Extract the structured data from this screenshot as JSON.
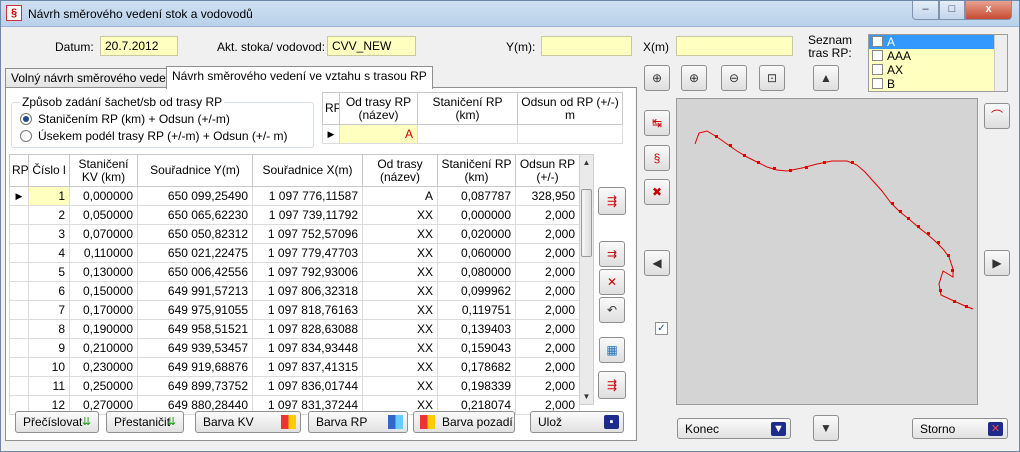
{
  "window": {
    "title": "Návrh směrového vedení stok a vodovodů",
    "min_glyph": "–",
    "max_glyph": "□",
    "close_glyph": "x"
  },
  "header": {
    "datum_label": "Datum:",
    "datum_value": "20.7.2012",
    "stoka_label": "Akt. stoka/ vodovod:",
    "stoka_value": "CVV_NEW",
    "y_label": "Y(m):",
    "y_value": "",
    "x_label": "X(m)",
    "x_value": "",
    "seznam_label": "Seznam tras RP:"
  },
  "trasy": [
    "A",
    "AAA",
    "AX",
    "B"
  ],
  "tabs": [
    "Volný návrh směrového vedení",
    "Návrh směrového vedení ve vztahu s trasou RP"
  ],
  "mode": {
    "title": "Způsob zadání šachet/sb od trasy RP",
    "opt1": "Staničením RP (km) + Odsun (+/-m)",
    "opt2": "Úsekem podél trasy RP (+/-m) + Odsun (+/- m)"
  },
  "rp_grid": {
    "headers": [
      "RP",
      "Od trasy RP (název)",
      "Staničení RP (km)",
      "Odsun od RP (+/-) m"
    ],
    "row": {
      "od_trasy": "A",
      "staniceni": "",
      "odsun": ""
    }
  },
  "grid": {
    "headers": [
      "RP",
      "Číslo l",
      "Staničení KV (km)",
      "Souřadnice Y(m)",
      "Souřadnice X(m)",
      "Od trasy (název)",
      "Staničení RP (km)",
      "Odsun RP (+/-)"
    ],
    "rows": [
      [
        "1",
        "0,000000",
        "650 099,25490",
        "1 097 776,11587",
        "A",
        "0,087787",
        "328,950"
      ],
      [
        "2",
        "0,050000",
        "650 065,62230",
        "1 097 739,11792",
        "XX",
        "0,000000",
        "2,000"
      ],
      [
        "3",
        "0,070000",
        "650 050,82312",
        "1 097 752,57096",
        "XX",
        "0,020000",
        "2,000"
      ],
      [
        "4",
        "0,110000",
        "650 021,22475",
        "1 097 779,47703",
        "XX",
        "0,060000",
        "2,000"
      ],
      [
        "5",
        "0,130000",
        "650 006,42556",
        "1 097 792,93006",
        "XX",
        "0,080000",
        "2,000"
      ],
      [
        "6",
        "0,150000",
        "649 991,57213",
        "1 097 806,32318",
        "XX",
        "0,099962",
        "2,000"
      ],
      [
        "7",
        "0,170000",
        "649 975,91055",
        "1 097 818,76163",
        "XX",
        "0,119751",
        "2,000"
      ],
      [
        "8",
        "0,190000",
        "649 958,51521",
        "1 097 828,63088",
        "XX",
        "0,139403",
        "2,000"
      ],
      [
        "9",
        "0,210000",
        "649 939,53457",
        "1 097 834,93448",
        "XX",
        "0,159043",
        "2,000"
      ],
      [
        "10",
        "0,230000",
        "649 919,68876",
        "1 097 837,41315",
        "XX",
        "0,178682",
        "2,000"
      ],
      [
        "11",
        "0,250000",
        "649 899,73752",
        "1 097 836,01744",
        "XX",
        "0,198339",
        "2,000"
      ],
      [
        "12",
        "0,270000",
        "649 880,28440",
        "1 097 831,37244",
        "XX",
        "0,218074",
        "2,000"
      ]
    ]
  },
  "buttons": {
    "precislovat": "Přečíslovat",
    "prestanicit": "Přestaničit",
    "barva_kv": "Barva KV",
    "barva_rp": "Barva RP",
    "barva_pozadi": "Barva pozadí",
    "uloz": "Ulož",
    "konec": "Konec",
    "storno": "Storno"
  },
  "colors": {
    "field_yellow": "#ffffc0",
    "route_red": "#e00000",
    "map_bg": "#d4d4d4"
  },
  "icons": [
    "zoom-extent-icon",
    "zoom-in-icon",
    "zoom-out-icon",
    "zoom-window-icon",
    "arrow-up-icon",
    "arrow-down-icon",
    "arrow-left-icon",
    "arrow-right-icon",
    "insert-row-icon",
    "delete-row-icon",
    "undo-icon",
    "calculator-icon",
    "save-disk-icon",
    "exit-door-icon"
  ]
}
